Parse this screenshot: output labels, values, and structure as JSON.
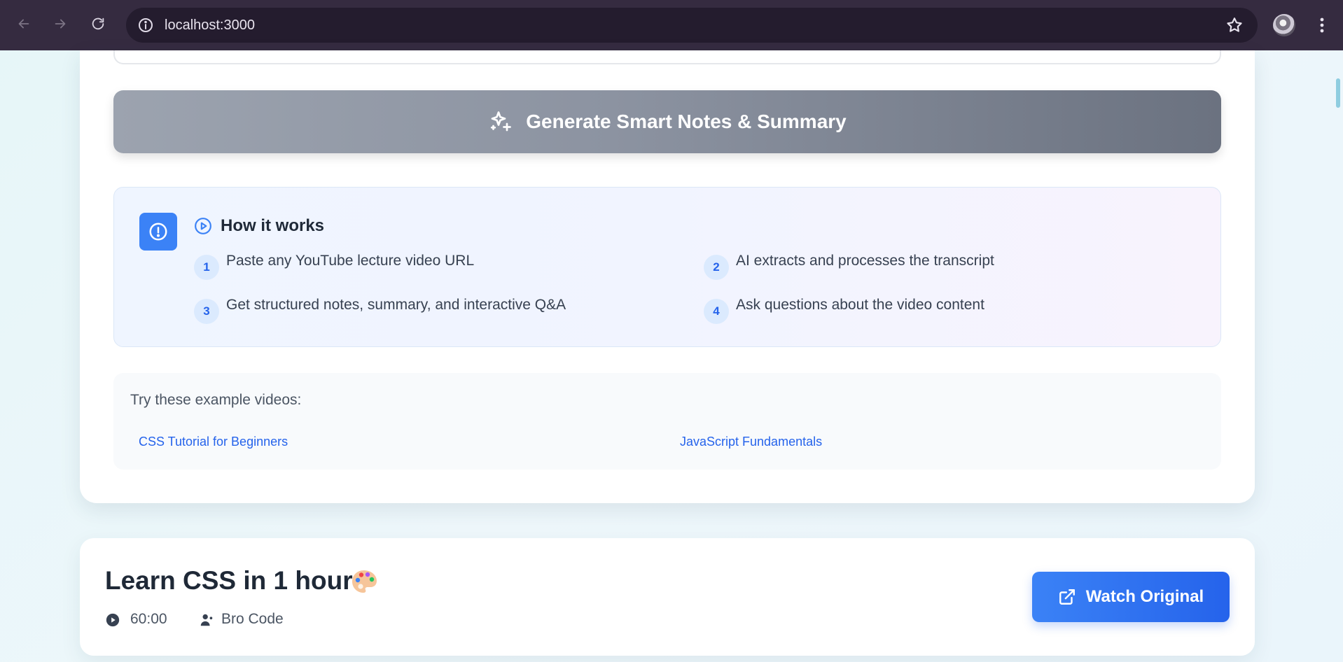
{
  "browser": {
    "url": "localhost:3000"
  },
  "main": {
    "generate_button_label": "Generate Smart Notes & Summary",
    "how_it_works": {
      "title": "How it works",
      "steps": [
        {
          "num": "1",
          "text": "Paste any YouTube lecture video URL"
        },
        {
          "num": "2",
          "text": "AI extracts and processes the transcript"
        },
        {
          "num": "3",
          "text": "Get structured notes, summary, and interactive Q&A"
        },
        {
          "num": "4",
          "text": "Ask questions about the video content"
        }
      ]
    },
    "examples": {
      "title": "Try these example videos:",
      "links": [
        "CSS Tutorial for Beginners",
        "JavaScript Fundamentals"
      ]
    }
  },
  "video": {
    "title": "Learn CSS in 1 hour",
    "duration": "60:00",
    "author": "Bro Code",
    "watch_button_label": "Watch Original"
  },
  "colors": {
    "chrome_bg": "#352b40",
    "accent": "#3b82f6",
    "accent_dark": "#2563eb",
    "disabled_button": "#8c93a1"
  }
}
